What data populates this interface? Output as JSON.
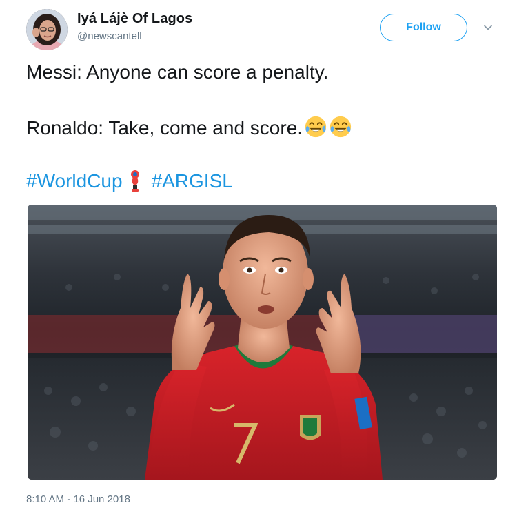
{
  "user": {
    "display_name": "Iyá Lájè Of Lagos",
    "handle": "@newscantell",
    "avatar_icon": "profile-photo"
  },
  "follow": {
    "label": "Follow"
  },
  "more_menu_icon": "chevron-down-icon",
  "tweet": {
    "line1": "Messi: Anyone can score a penalty.",
    "line2": "Ronaldo: Take, come and score.",
    "line2_emoji": "face-with-tears-of-joy",
    "hashtags": [
      "#WorldCup",
      "#ARGISL"
    ],
    "hashtag_emoji": "world-cup-trophy"
  },
  "media": {
    "type": "photo"
  },
  "timestamp": "8:10 AM - 16 Jun 2018",
  "colors": {
    "accent": "#1da1f2",
    "link": "#1b95e0",
    "secondary_text": "#657786",
    "text": "#14171a"
  }
}
